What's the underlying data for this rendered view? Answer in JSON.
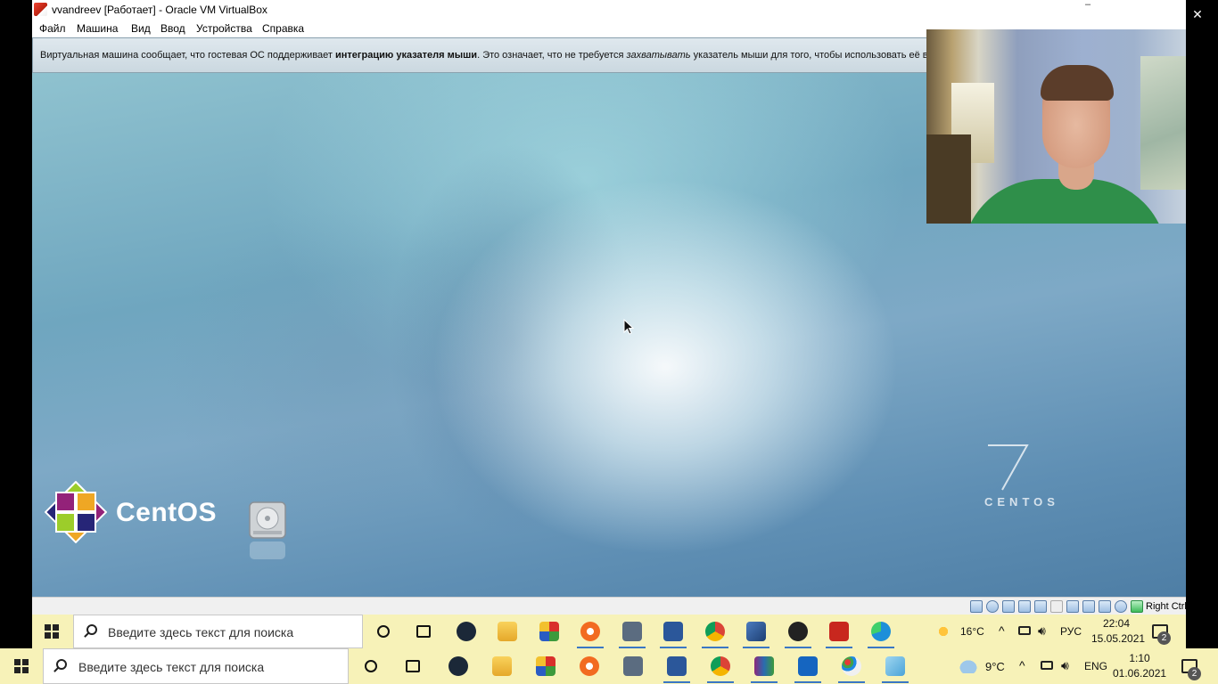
{
  "window": {
    "title": "vvandreev [Работает] - Oracle VM VirtualBox",
    "app_icon": "virtualbox-icon",
    "controls": [
      "minimize-icon",
      "restore-icon",
      "close-icon"
    ]
  },
  "menu": {
    "items": [
      "Файл",
      "Машина",
      "Вид",
      "Ввод",
      "Устройства",
      "Справка"
    ]
  },
  "notice": {
    "part1": "Виртуальная машина сообщает, что гостевая ОС поддерживает ",
    "bold": "интеграцию указателя мыши",
    "part2": ". Это означает, что не требуется ",
    "italic": "захватывать",
    "part3": " указатель мыши для того, чтобы использовать её в госте"
  },
  "guest": {
    "logo_text": "CentOS",
    "version_mark": "7",
    "version_caption": "CENTOS",
    "icons": [
      "centos-logo-icon",
      "hard-disk-icon",
      "mouse-cursor-icon"
    ]
  },
  "statusbar": {
    "icons": [
      "hdd-status-icon",
      "optical-disk-icon",
      "audio-icon",
      "network-icon",
      "usb-icon",
      "shared-folder-icon",
      "display-icon",
      "video-capture-icon",
      "cpu-icon",
      "mouse-integration-icon",
      "keyboard-icon"
    ],
    "host_key": "Right Ctrl"
  },
  "inner_taskbar": {
    "search_placeholder": "Введите здесь текст для поиска",
    "apps": [
      "steam-icon",
      "file-explorer-icon",
      "winrar-icon",
      "origin-icon",
      "calculator-icon",
      "word-icon",
      "chrome-icon",
      "virtualbox-icon",
      "obs-icon",
      "recorder-icon",
      "edge-icon"
    ],
    "weather": "16°C",
    "language": "РУС",
    "time": "22:04",
    "date": "15.05.2021",
    "notification_count": "2"
  },
  "outer_taskbar": {
    "search_placeholder": "Введите здесь текст для поиска",
    "apps": [
      "steam-icon",
      "file-explorer-icon",
      "winrar-icon",
      "origin-icon",
      "calculator-icon",
      "word-icon",
      "chrome-icon",
      "rar-archive-icon",
      "media-player-icon",
      "paint-icon",
      "notepad-icon"
    ],
    "weather": "9°C",
    "language": "ENG",
    "time": "1:10",
    "date": "01.06.2021",
    "notification_count": "2"
  },
  "colors": {
    "taskbar": "#f7f2b8",
    "accent": "#3a77c4",
    "desktop": "#6fa6bf"
  }
}
